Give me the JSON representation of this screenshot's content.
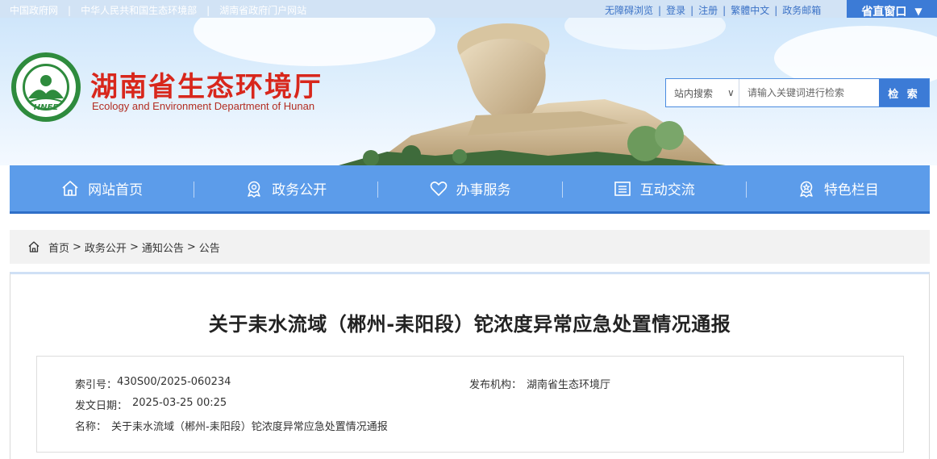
{
  "topbar": {
    "left_links": [
      "中国政府网",
      "中华人民共和国生态环境部",
      "湖南省政府门户网站"
    ],
    "right_links": [
      "无障碍浏览",
      "登录",
      "注册",
      "繁體中文",
      "政务邮箱"
    ],
    "window_button": "省直窗口",
    "window_caret": "▼"
  },
  "header": {
    "logo_text": "HNEE",
    "title": "湖南省生态环境厅",
    "subtitle": "Ecology and Environment Department of Hunan"
  },
  "search": {
    "scope": "站内搜索",
    "scope_caret": "∨",
    "placeholder": "请输入关键词进行检索",
    "button": "检 索"
  },
  "nav": {
    "items": [
      {
        "label": "网站首页",
        "icon": "home-icon"
      },
      {
        "label": "政务公开",
        "icon": "badge-icon"
      },
      {
        "label": "办事服务",
        "icon": "heart-icon"
      },
      {
        "label": "互动交流",
        "icon": "list-icon"
      },
      {
        "label": "特色栏目",
        "icon": "award-icon"
      }
    ]
  },
  "breadcrumb": {
    "items": [
      "首页",
      "政务公开",
      "通知公告",
      "公告"
    ],
    "separator": ">"
  },
  "article": {
    "title": "关于耒水流域（郴州-耒阳段）铊浓度异常应急处置情况通报",
    "meta": {
      "index_label": "索引号：",
      "index_value": "430S00/2025-060234",
      "publisher_label": "发布机构：",
      "publisher_value": "湖南省生态环境厅",
      "date_label": "发文日期：",
      "date_value": "2025-03-25 00:25",
      "name_label": "名称：",
      "name_value": "关于耒水流域（郴州-耒阳段）铊浓度异常应急处置情况通报"
    }
  },
  "colors": {
    "nav_blue": "#5c9cea",
    "accent_blue": "#3c7bd6",
    "title_red": "#d8271c",
    "logo_green": "#2e8b3d"
  }
}
